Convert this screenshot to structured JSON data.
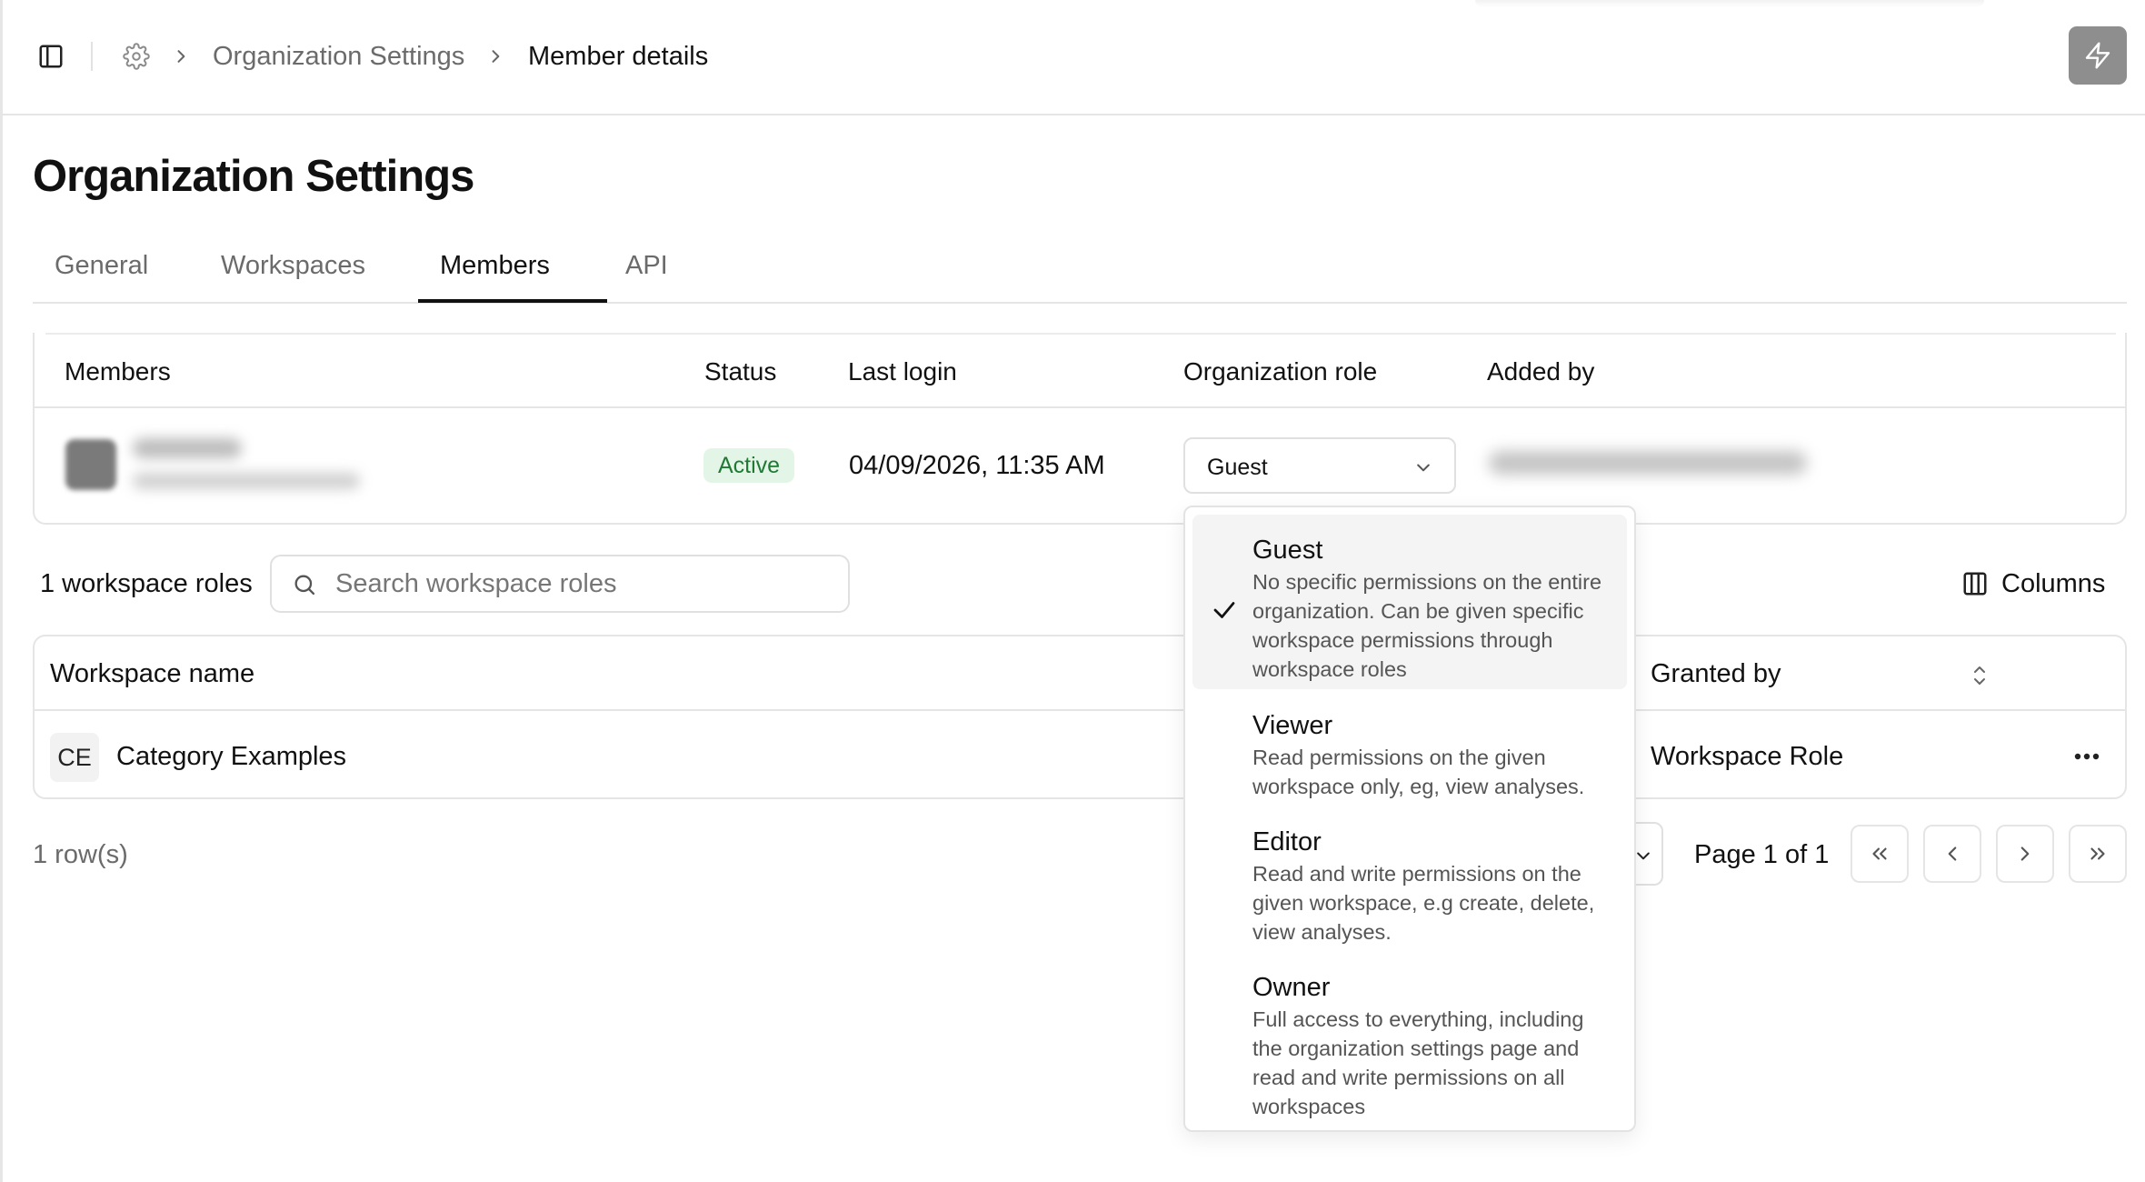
{
  "breadcrumb": {
    "items": [
      "Organization Settings",
      "Member details"
    ]
  },
  "page": {
    "title": "Organization Settings"
  },
  "tabs": [
    {
      "label": "General",
      "active": false
    },
    {
      "label": "Workspaces",
      "active": false
    },
    {
      "label": "Members",
      "active": true
    },
    {
      "label": "API",
      "active": false
    }
  ],
  "members_table": {
    "columns": [
      "Members",
      "Status",
      "Last login",
      "Organization role",
      "Added by"
    ],
    "row": {
      "status": "Active",
      "last_login": "04/09/2026, 11:35 AM",
      "organization_role": "Guest"
    }
  },
  "role_dropdown": {
    "options": [
      {
        "title": "Guest",
        "description": "No specific permissions on the entire organization. Can be given specific workspace permissions through workspace roles",
        "selected": true
      },
      {
        "title": "Viewer",
        "description": "Read permissions on the given workspace only, eg, view analyses.",
        "selected": false
      },
      {
        "title": "Editor",
        "description": "Read and write permissions on the given workspace, e.g create, delete, view analyses.",
        "selected": false
      },
      {
        "title": "Owner",
        "description": "Full access to everything, including the organization settings page and read and write permissions on all workspaces",
        "selected": false
      }
    ]
  },
  "workspace_roles": {
    "count_label": "1 workspace roles",
    "search_placeholder": "Search workspace roles",
    "columns_button": "Columns",
    "columns": [
      "Workspace name",
      "Granted by"
    ],
    "rows": [
      {
        "initials": "CE",
        "name": "Category Examples",
        "granted_by": "Workspace Role"
      }
    ]
  },
  "pagination": {
    "row_count": "1 row(s)",
    "page_label": "Page 1 of 1"
  },
  "colors": {
    "status_active_bg": "#e3f5e7",
    "status_active_text": "#1f7a34",
    "bolt_button_bg": "#8e8e8e"
  },
  "icons": [
    "sidebar-toggle-icon",
    "gear-icon",
    "chevron-right-icon",
    "bolt-icon",
    "chevron-down-icon",
    "search-icon",
    "columns-icon",
    "sort-icon",
    "more-horizontal-icon",
    "check-icon",
    "chevrons-left-icon",
    "chevron-left-icon",
    "chevrons-right-icon"
  ]
}
